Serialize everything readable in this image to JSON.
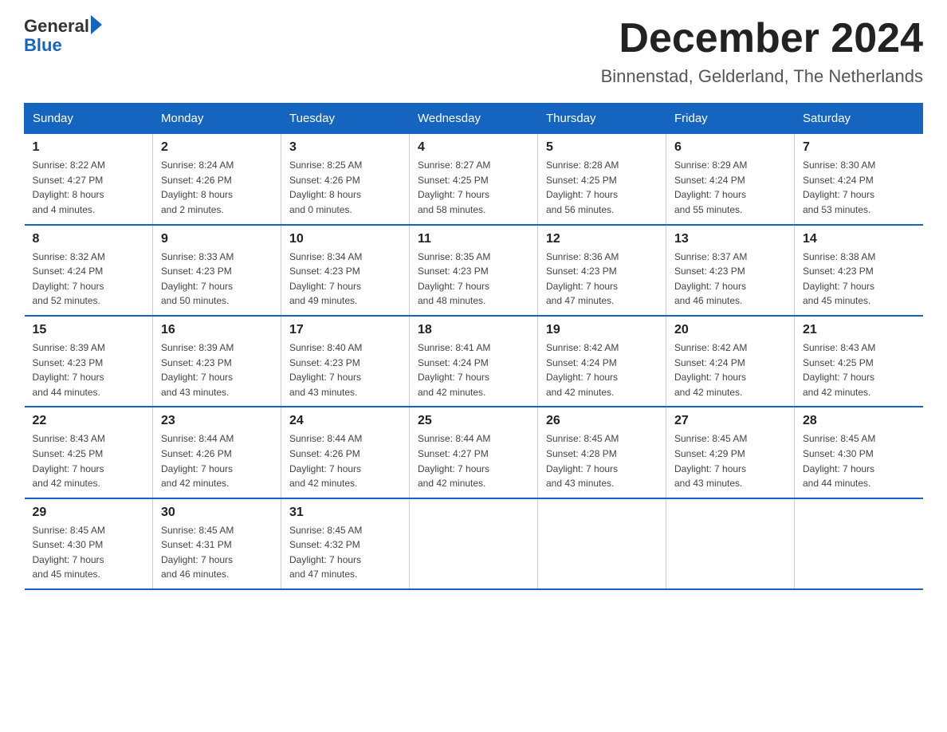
{
  "header": {
    "logo_general": "General",
    "logo_triangle": "▶",
    "logo_blue": "Blue",
    "month_title": "December 2024",
    "location": "Binnenstad, Gelderland, The Netherlands"
  },
  "weekdays": [
    "Sunday",
    "Monday",
    "Tuesday",
    "Wednesday",
    "Thursday",
    "Friday",
    "Saturday"
  ],
  "weeks": [
    [
      {
        "day": "1",
        "sunrise": "8:22 AM",
        "sunset": "4:27 PM",
        "daylight": "8 hours and 4 minutes."
      },
      {
        "day": "2",
        "sunrise": "8:24 AM",
        "sunset": "4:26 PM",
        "daylight": "8 hours and 2 minutes."
      },
      {
        "day": "3",
        "sunrise": "8:25 AM",
        "sunset": "4:26 PM",
        "daylight": "8 hours and 0 minutes."
      },
      {
        "day": "4",
        "sunrise": "8:27 AM",
        "sunset": "4:25 PM",
        "daylight": "7 hours and 58 minutes."
      },
      {
        "day": "5",
        "sunrise": "8:28 AM",
        "sunset": "4:25 PM",
        "daylight": "7 hours and 56 minutes."
      },
      {
        "day": "6",
        "sunrise": "8:29 AM",
        "sunset": "4:24 PM",
        "daylight": "7 hours and 55 minutes."
      },
      {
        "day": "7",
        "sunrise": "8:30 AM",
        "sunset": "4:24 PM",
        "daylight": "7 hours and 53 minutes."
      }
    ],
    [
      {
        "day": "8",
        "sunrise": "8:32 AM",
        "sunset": "4:24 PM",
        "daylight": "7 hours and 52 minutes."
      },
      {
        "day": "9",
        "sunrise": "8:33 AM",
        "sunset": "4:23 PM",
        "daylight": "7 hours and 50 minutes."
      },
      {
        "day": "10",
        "sunrise": "8:34 AM",
        "sunset": "4:23 PM",
        "daylight": "7 hours and 49 minutes."
      },
      {
        "day": "11",
        "sunrise": "8:35 AM",
        "sunset": "4:23 PM",
        "daylight": "7 hours and 48 minutes."
      },
      {
        "day": "12",
        "sunrise": "8:36 AM",
        "sunset": "4:23 PM",
        "daylight": "7 hours and 47 minutes."
      },
      {
        "day": "13",
        "sunrise": "8:37 AM",
        "sunset": "4:23 PM",
        "daylight": "7 hours and 46 minutes."
      },
      {
        "day": "14",
        "sunrise": "8:38 AM",
        "sunset": "4:23 PM",
        "daylight": "7 hours and 45 minutes."
      }
    ],
    [
      {
        "day": "15",
        "sunrise": "8:39 AM",
        "sunset": "4:23 PM",
        "daylight": "7 hours and 44 minutes."
      },
      {
        "day": "16",
        "sunrise": "8:39 AM",
        "sunset": "4:23 PM",
        "daylight": "7 hours and 43 minutes."
      },
      {
        "day": "17",
        "sunrise": "8:40 AM",
        "sunset": "4:23 PM",
        "daylight": "7 hours and 43 minutes."
      },
      {
        "day": "18",
        "sunrise": "8:41 AM",
        "sunset": "4:24 PM",
        "daylight": "7 hours and 42 minutes."
      },
      {
        "day": "19",
        "sunrise": "8:42 AM",
        "sunset": "4:24 PM",
        "daylight": "7 hours and 42 minutes."
      },
      {
        "day": "20",
        "sunrise": "8:42 AM",
        "sunset": "4:24 PM",
        "daylight": "7 hours and 42 minutes."
      },
      {
        "day": "21",
        "sunrise": "8:43 AM",
        "sunset": "4:25 PM",
        "daylight": "7 hours and 42 minutes."
      }
    ],
    [
      {
        "day": "22",
        "sunrise": "8:43 AM",
        "sunset": "4:25 PM",
        "daylight": "7 hours and 42 minutes."
      },
      {
        "day": "23",
        "sunrise": "8:44 AM",
        "sunset": "4:26 PM",
        "daylight": "7 hours and 42 minutes."
      },
      {
        "day": "24",
        "sunrise": "8:44 AM",
        "sunset": "4:26 PM",
        "daylight": "7 hours and 42 minutes."
      },
      {
        "day": "25",
        "sunrise": "8:44 AM",
        "sunset": "4:27 PM",
        "daylight": "7 hours and 42 minutes."
      },
      {
        "day": "26",
        "sunrise": "8:45 AM",
        "sunset": "4:28 PM",
        "daylight": "7 hours and 43 minutes."
      },
      {
        "day": "27",
        "sunrise": "8:45 AM",
        "sunset": "4:29 PM",
        "daylight": "7 hours and 43 minutes."
      },
      {
        "day": "28",
        "sunrise": "8:45 AM",
        "sunset": "4:30 PM",
        "daylight": "7 hours and 44 minutes."
      }
    ],
    [
      {
        "day": "29",
        "sunrise": "8:45 AM",
        "sunset": "4:30 PM",
        "daylight": "7 hours and 45 minutes."
      },
      {
        "day": "30",
        "sunrise": "8:45 AM",
        "sunset": "4:31 PM",
        "daylight": "7 hours and 46 minutes."
      },
      {
        "day": "31",
        "sunrise": "8:45 AM",
        "sunset": "4:32 PM",
        "daylight": "7 hours and 47 minutes."
      },
      null,
      null,
      null,
      null
    ]
  ],
  "labels": {
    "sunrise": "Sunrise:",
    "sunset": "Sunset:",
    "daylight": "Daylight:"
  }
}
